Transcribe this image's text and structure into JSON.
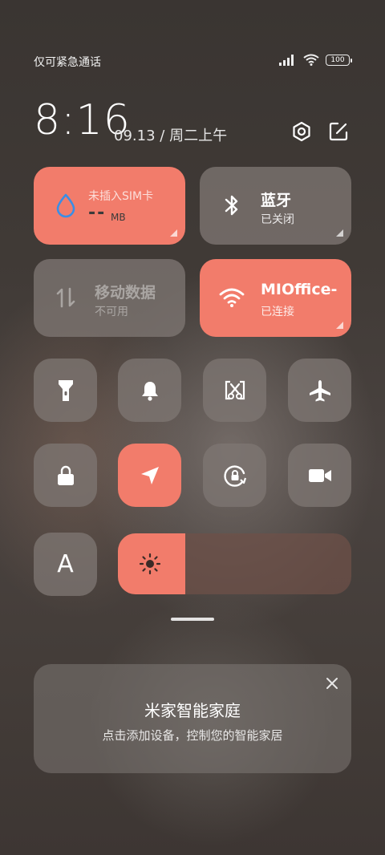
{
  "status_bar": {
    "carrier_text": "仅可紧急通话",
    "battery_level": "100"
  },
  "header": {
    "time": "8:16",
    "date": "09.13",
    "separator": "/",
    "weekday": "周二上午"
  },
  "tiles_large": [
    {
      "id": "data-usage",
      "top_text": "未插入SIM卡",
      "value": "--",
      "unit": "MB",
      "active": true
    },
    {
      "id": "bluetooth",
      "title": "蓝牙",
      "subtitle": "已关闭",
      "active": false
    },
    {
      "id": "mobile-data",
      "title": "移动数据",
      "subtitle": "不可用",
      "active": false,
      "disabled": true
    },
    {
      "id": "wifi",
      "title": "MIOffice-",
      "subtitle": "已连接",
      "active": true
    }
  ],
  "tiles_small": [
    {
      "icon": "flashlight-icon",
      "active": false
    },
    {
      "icon": "bell-icon",
      "active": false
    },
    {
      "icon": "screenshot-icon",
      "active": false
    },
    {
      "icon": "airplane-icon",
      "active": false
    },
    {
      "icon": "lock-icon",
      "active": false
    },
    {
      "icon": "location-icon",
      "active": true
    },
    {
      "icon": "rotation-lock-icon",
      "active": false
    },
    {
      "icon": "video-camera-icon",
      "active": false
    },
    {
      "icon": "font-size-icon",
      "label": "A",
      "active": false
    }
  ],
  "brightness": {
    "level_percent": 29
  },
  "card": {
    "title": "米家智能家庭",
    "subtitle": "点击添加设备，控制您的智能家居"
  },
  "colors": {
    "accent": "#f27c6b",
    "tile": "#7d7672"
  }
}
